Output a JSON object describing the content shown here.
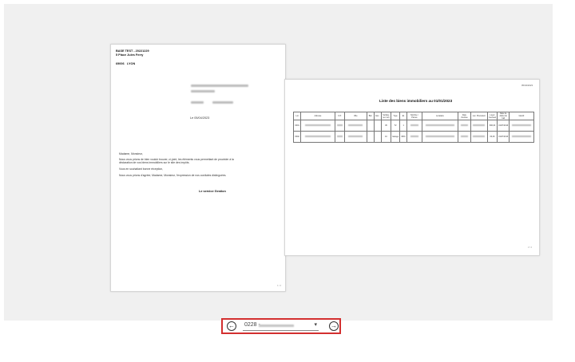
{
  "document": {
    "letter": {
      "company_line1": "BASE TEST - 20221229",
      "company_line2": "5 Place Jules Ferry",
      "postcode": "69006",
      "city": "LYON",
      "date_line": "Le 05/04/2023",
      "salutation": "Madame, Monsieur,",
      "paragraph1_line1": "Nous vous prions de bien vouloir trouver, ci-joint, les éléments vous permettant de procéder à la",
      "paragraph1_line2": "déclaration de vos biens immobiliers sur le site des impôts.",
      "paragraph2": "Vous en souhaitant bonne réception,",
      "paragraph3": "Nous vous prions d'agréer, Madame, Monsieur, l'expression de nos cordiales distinguées.",
      "signature": "Le service Gestion",
      "page_number": "1 / 2"
    },
    "list_page": {
      "date": "05/04/2023",
      "title": "Liste des biens immobiliers au 01/01/2023",
      "page_number": "2 / 2",
      "columns": [
        "Lot",
        "Adresse",
        "C.P.",
        "Ville",
        "Bât",
        "Esc.",
        "Surface (en m2)",
        "Type",
        "Et.",
        "Nombre / Pièces",
        "Locataire",
        "Date d'entrée",
        "Loc. Précédent",
        "Loyer mensuel",
        "Date de début du bail",
        "Identif."
      ],
      "rows": [
        {
          "lot": "0001",
          "surface": "45",
          "type": "T2",
          "et": "1",
          "loyer": "600,00",
          "date": "01/07/2019"
        },
        {
          "lot": "0002",
          "surface": "10",
          "type": "Garage",
          "et": "RDC",
          "loyer": "60,00",
          "date": "01/07/2019"
        }
      ]
    }
  },
  "navigator": {
    "selected_prefix": "0228 -",
    "prev_icon": "circle-arrow-left-icon",
    "next_icon": "circle-arrow-right-icon",
    "accent_color": "#d32f2f"
  }
}
